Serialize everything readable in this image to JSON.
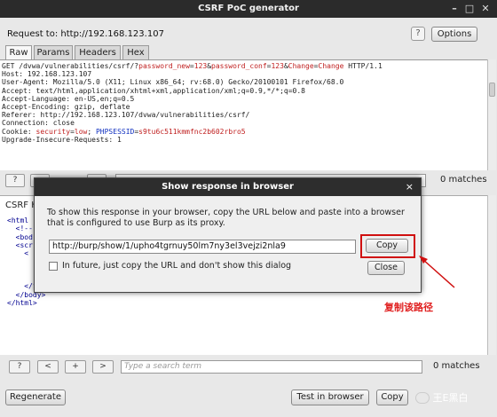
{
  "window": {
    "title": "CSRF PoC generator",
    "controls": [
      "–",
      "□",
      "✕"
    ]
  },
  "request": {
    "label": "Request to:",
    "url": "http://192.168.123.107",
    "help": "?",
    "options": "Options"
  },
  "tabs": [
    "Raw",
    "Params",
    "Headers",
    "Hex"
  ],
  "raw_lines": {
    "l1a": "GET /dvwa/vulnerabilities/csrf/?",
    "l1p1": "password_new",
    "l1b": "=",
    "l1v1": "123",
    "l1c": "&",
    "l1p2": "password_conf",
    "l1d": "=",
    "l1v2": "123",
    "l1e": "&",
    "l1p3": "Change",
    "l1f": "=",
    "l1v3": "Change",
    "l1g": " HTTP/1.1",
    "l2": "Host: 192.168.123.107",
    "l3": "User-Agent: Mozilla/5.0 (X11; Linux x86_64; rv:68.0) Gecko/20100101 Firefox/68.0",
    "l4": "Accept: text/html,application/xhtml+xml,application/xml;q=0.9,*/*;q=0.8",
    "l5": "Accept-Language: en-US,en;q=0.5",
    "l6": "Accept-Encoding: gzip, deflate",
    "l7": "Referer: http://192.168.123.107/dvwa/vulnerabilities/csrf/",
    "l8": "Connection: close",
    "l9a": "Cookie: ",
    "l9b": "security",
    "l9c": "=",
    "l9d": "low",
    "l9e": "; ",
    "l9f": "PHPSESSID",
    "l9g": "=",
    "l9h": "s9tu6c511kmmfnc2b602rbro5",
    "l10": "Upgrade-Insecure-Requests: 1"
  },
  "search1": {
    "help": "?",
    "matches": "0 matches"
  },
  "csrf_html": {
    "label": "CSRF H",
    "lines": [
      "<html",
      "  <!--",
      "  <bod",
      "  <scr",
      "    <",
      "",
      "",
      "",
      "    </form>",
      "  </body>",
      "</html>"
    ]
  },
  "search2": {
    "help": "?",
    "prev": "<",
    "add": "+",
    "next": ">",
    "placeholder": "Type a search term",
    "matches": "0 matches"
  },
  "buttons": {
    "regenerate": "Regenerate",
    "test": "Test in browser",
    "copy_html": "Copy"
  },
  "dialog": {
    "title": "Show response in browser",
    "close": "×",
    "message": "To show this response in your browser, copy the URL below and paste into a browser that is configured to use Burp as its proxy.",
    "url": "http://burp/show/1/upho4tgrnuy50lm7ny3el3vejzi2nla9",
    "copy": "Copy",
    "checkbox_label": "In future, just copy the URL and don't show this dialog",
    "close_btn": "Close"
  },
  "annotation": "复制该路径",
  "watermark": "王E黑白",
  "colors": {
    "param": "#c02020",
    "cookie_name": "#1030c0",
    "highlight": "#d01010",
    "annotation": "#e02020"
  }
}
